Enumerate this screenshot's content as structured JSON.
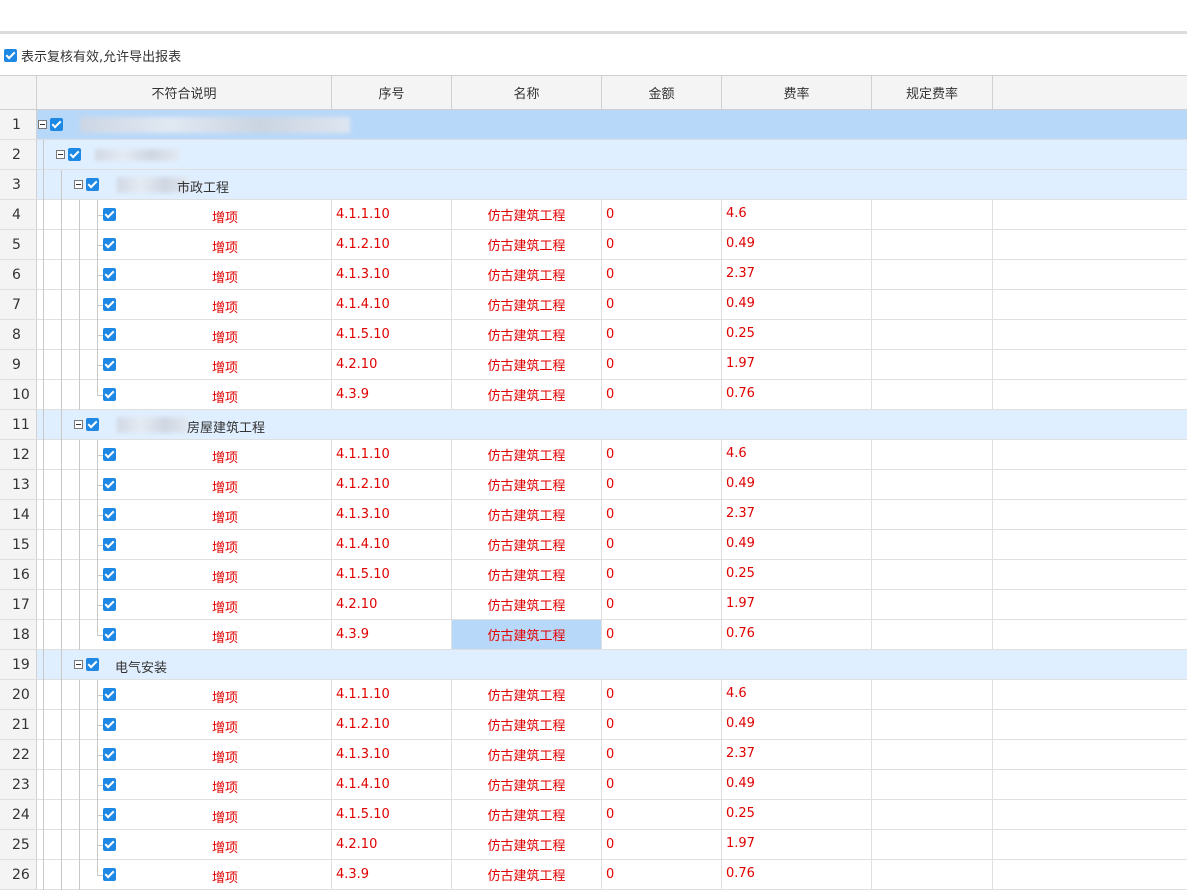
{
  "toolbar": {
    "option_label": "表示复核有效,允许导出报表",
    "option_checked": true
  },
  "columns": [
    "不符合说明",
    "序号",
    "名称",
    "金额",
    "费率",
    "规定费率"
  ],
  "rows": [
    {
      "n": "1",
      "type": "l1",
      "label": ""
    },
    {
      "n": "2",
      "type": "l2",
      "label": ""
    },
    {
      "n": "3",
      "type": "l3",
      "label": "市政工程"
    },
    {
      "n": "4",
      "type": "leaf",
      "desc": "增项",
      "seq": "4.1.1.10",
      "name": "仿古建筑工程",
      "amount": "0",
      "rate": "4.6",
      "std_rate": ""
    },
    {
      "n": "5",
      "type": "leaf",
      "desc": "增项",
      "seq": "4.1.2.10",
      "name": "仿古建筑工程",
      "amount": "0",
      "rate": "0.49",
      "std_rate": ""
    },
    {
      "n": "6",
      "type": "leaf",
      "desc": "增项",
      "seq": "4.1.3.10",
      "name": "仿古建筑工程",
      "amount": "0",
      "rate": "2.37",
      "std_rate": ""
    },
    {
      "n": "7",
      "type": "leaf",
      "desc": "增项",
      "seq": "4.1.4.10",
      "name": "仿古建筑工程",
      "amount": "0",
      "rate": "0.49",
      "std_rate": ""
    },
    {
      "n": "8",
      "type": "leaf",
      "desc": "增项",
      "seq": "4.1.5.10",
      "name": "仿古建筑工程",
      "amount": "0",
      "rate": "0.25",
      "std_rate": ""
    },
    {
      "n": "9",
      "type": "leaf",
      "desc": "增项",
      "seq": "4.2.10",
      "name": "仿古建筑工程",
      "amount": "0",
      "rate": "1.97",
      "std_rate": ""
    },
    {
      "n": "10",
      "type": "leaf",
      "desc": "增项",
      "seq": "4.3.9",
      "name": "仿古建筑工程",
      "amount": "0",
      "rate": "0.76",
      "std_rate": ""
    },
    {
      "n": "11",
      "type": "l3",
      "label": "房屋建筑工程"
    },
    {
      "n": "12",
      "type": "leaf",
      "desc": "增项",
      "seq": "4.1.1.10",
      "name": "仿古建筑工程",
      "amount": "0",
      "rate": "4.6",
      "std_rate": ""
    },
    {
      "n": "13",
      "type": "leaf",
      "desc": "增项",
      "seq": "4.1.2.10",
      "name": "仿古建筑工程",
      "amount": "0",
      "rate": "0.49",
      "std_rate": ""
    },
    {
      "n": "14",
      "type": "leaf",
      "desc": "增项",
      "seq": "4.1.3.10",
      "name": "仿古建筑工程",
      "amount": "0",
      "rate": "2.37",
      "std_rate": ""
    },
    {
      "n": "15",
      "type": "leaf",
      "desc": "增项",
      "seq": "4.1.4.10",
      "name": "仿古建筑工程",
      "amount": "0",
      "rate": "0.49",
      "std_rate": ""
    },
    {
      "n": "16",
      "type": "leaf",
      "desc": "增项",
      "seq": "4.1.5.10",
      "name": "仿古建筑工程",
      "amount": "0",
      "rate": "0.25",
      "std_rate": ""
    },
    {
      "n": "17",
      "type": "leaf",
      "desc": "增项",
      "seq": "4.2.10",
      "name": "仿古建筑工程",
      "amount": "0",
      "rate": "1.97",
      "std_rate": ""
    },
    {
      "n": "18",
      "type": "leaf",
      "desc": "增项",
      "seq": "4.3.9",
      "name": "仿古建筑工程",
      "amount": "0",
      "rate": "0.76",
      "std_rate": "",
      "selected": true
    },
    {
      "n": "19",
      "type": "l3",
      "label": "电气安装"
    },
    {
      "n": "20",
      "type": "leaf",
      "desc": "增项",
      "seq": "4.1.1.10",
      "name": "仿古建筑工程",
      "amount": "0",
      "rate": "4.6",
      "std_rate": ""
    },
    {
      "n": "21",
      "type": "leaf",
      "desc": "增项",
      "seq": "4.1.2.10",
      "name": "仿古建筑工程",
      "amount": "0",
      "rate": "0.49",
      "std_rate": ""
    },
    {
      "n": "22",
      "type": "leaf",
      "desc": "增项",
      "seq": "4.1.3.10",
      "name": "仿古建筑工程",
      "amount": "0",
      "rate": "2.37",
      "std_rate": ""
    },
    {
      "n": "23",
      "type": "leaf",
      "desc": "增项",
      "seq": "4.1.4.10",
      "name": "仿古建筑工程",
      "amount": "0",
      "rate": "0.49",
      "std_rate": ""
    },
    {
      "n": "24",
      "type": "leaf",
      "desc": "增项",
      "seq": "4.1.5.10",
      "name": "仿古建筑工程",
      "amount": "0",
      "rate": "0.25",
      "std_rate": ""
    },
    {
      "n": "25",
      "type": "leaf",
      "desc": "增项",
      "seq": "4.2.10",
      "name": "仿古建筑工程",
      "amount": "0",
      "rate": "1.97",
      "std_rate": ""
    },
    {
      "n": "26",
      "type": "leaf",
      "desc": "增项",
      "seq": "4.3.9",
      "name": "仿古建筑工程",
      "amount": "0",
      "rate": "0.76",
      "std_rate": ""
    }
  ],
  "colors": {
    "accent": "#1e88e5",
    "error_text": "#e00000",
    "row_level1": "#b8d8f9",
    "row_group": "#e0efff"
  }
}
